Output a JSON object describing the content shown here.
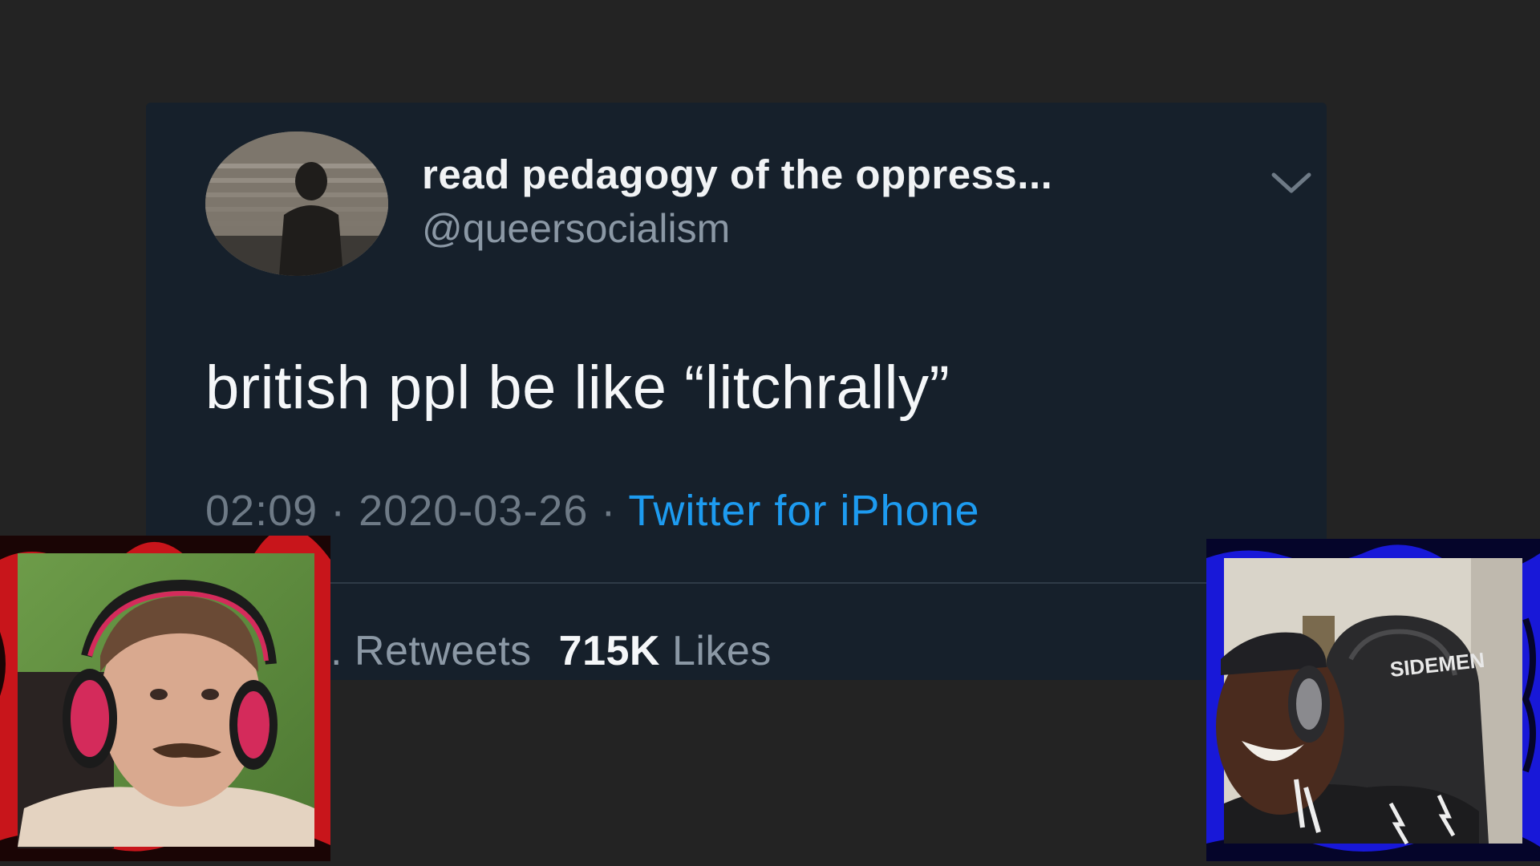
{
  "tweet": {
    "display_name": "read pedagogy of the oppress...",
    "handle": "@queersocialism",
    "text": "british ppl be like “litchrally”",
    "time": "02:09",
    "date": "2020-03-26",
    "separator": " · ",
    "source": "Twitter for iPhone",
    "retweets_label": "Retweets",
    "likes_count": "715K",
    "likes_label": "Likes",
    "retweets_count_visible": "."
  },
  "overlay": {
    "left_cam_icon": "webcam-feed",
    "right_cam_icon": "webcam-feed",
    "right_cam_chair_logo": "SIDEMEN"
  },
  "colors": {
    "background": "#232323",
    "card": "#16202b",
    "link": "#1d9bf0",
    "left_cam_frame": "#c8151b",
    "right_cam_frame": "#1818d8"
  }
}
